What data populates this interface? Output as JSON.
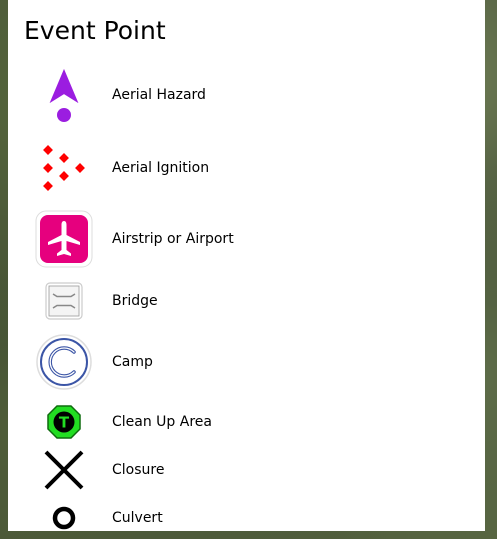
{
  "panel": {
    "title": "Event Point",
    "items": [
      {
        "label": "Aerial Hazard",
        "icon": "aerial-hazard-icon",
        "color": "#9b1de0"
      },
      {
        "label": "Aerial Ignition",
        "icon": "aerial-ignition-icon",
        "color": "#ff0000"
      },
      {
        "label": "Airstrip or Airport",
        "icon": "airport-icon",
        "color": "#e6007e"
      },
      {
        "label": "Bridge",
        "icon": "bridge-icon",
        "color": "#888888"
      },
      {
        "label": "Camp",
        "icon": "camp-icon",
        "color": "#3b55a6"
      },
      {
        "label": "Clean Up Area",
        "icon": "clean-up-icon",
        "color": "#22dd22"
      },
      {
        "label": "Closure",
        "icon": "closure-icon",
        "color": "#000000"
      },
      {
        "label": "Culvert",
        "icon": "culvert-icon",
        "color": "#000000"
      }
    ],
    "clean_up_letter": "T"
  }
}
